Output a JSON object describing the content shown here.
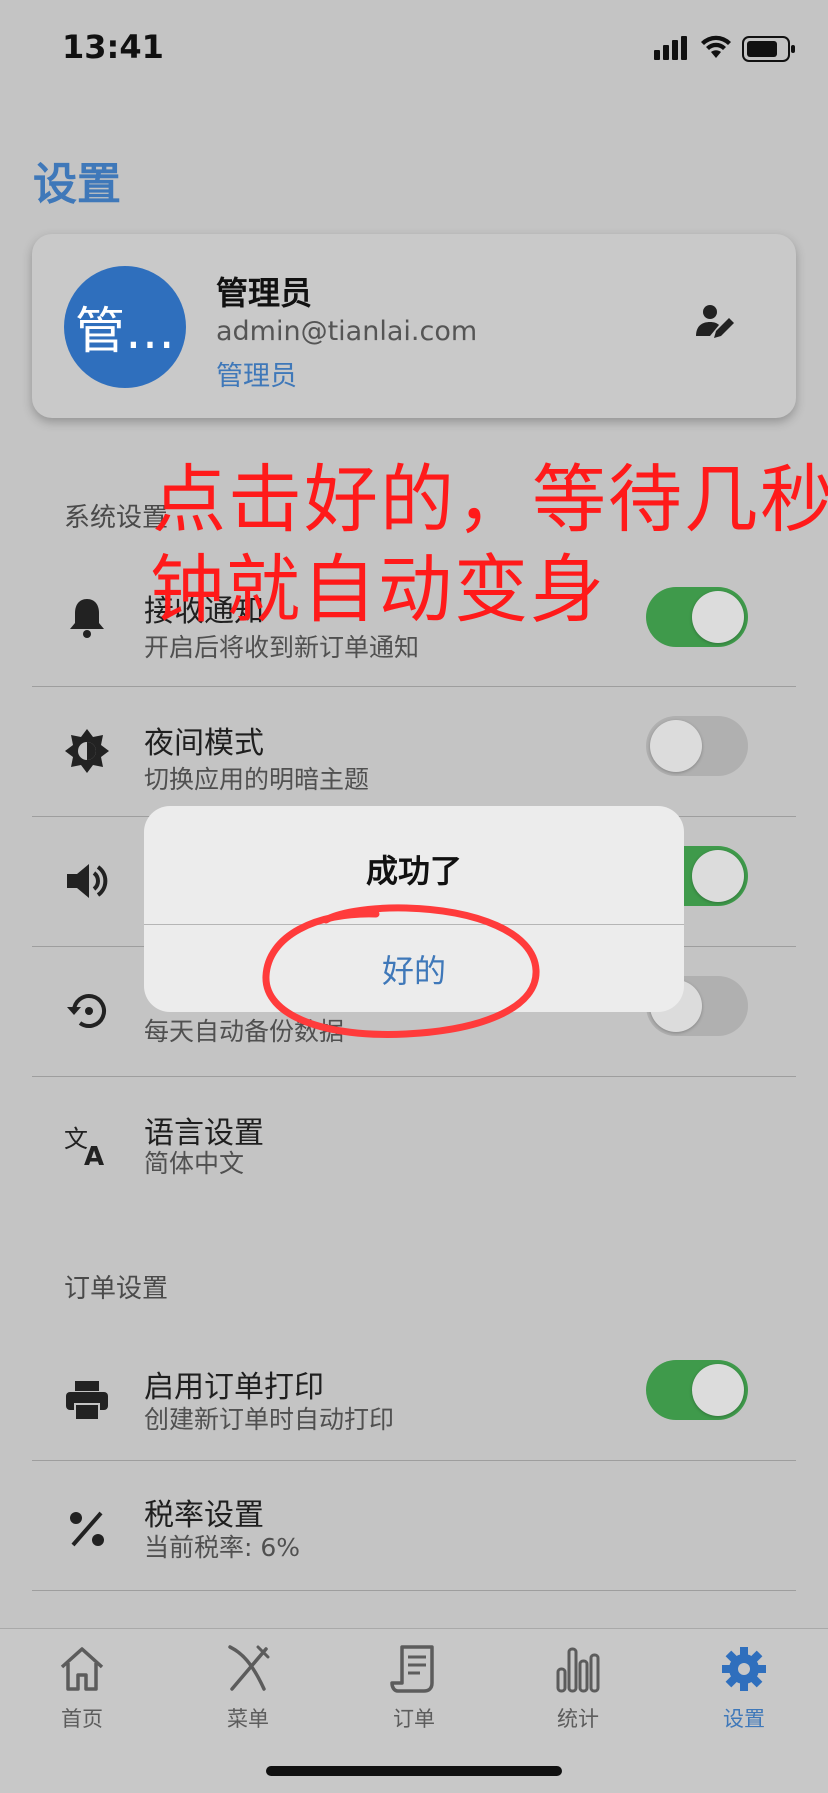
{
  "status_bar": {
    "time": "13:41"
  },
  "page": {
    "title": "设置"
  },
  "profile": {
    "avatar_text": "管…",
    "name": "管理员",
    "email": "admin@tianlai.com",
    "role": "管理员",
    "edit_icon": "user-edit-icon"
  },
  "sections": {
    "system_label": "系统设置",
    "order_label": "订单设置"
  },
  "system_settings": [
    {
      "icon": "bell-icon",
      "title": "接收通知",
      "subtitle": "开启后将收到新订单通知",
      "toggle": true
    },
    {
      "icon": "brightness-icon",
      "title": "夜间模式",
      "subtitle": "切换应用的明暗主题",
      "toggle": false
    },
    {
      "icon": "volume-icon",
      "title": "",
      "subtitle": "",
      "toggle": true
    },
    {
      "icon": "backup-restore-icon",
      "title": "",
      "subtitle": "每天自动备份数据",
      "toggle": false
    },
    {
      "icon": "translate-icon",
      "title": "语言设置",
      "subtitle": "简体中文"
    }
  ],
  "order_settings": [
    {
      "icon": "printer-icon",
      "title": "启用订单打印",
      "subtitle": "创建新订单时自动打印",
      "toggle": true
    },
    {
      "icon": "percent-icon",
      "title": "税率设置",
      "subtitle": "当前税率: 6%"
    }
  ],
  "annotation": {
    "line1": "点击好的，等待几秒",
    "line2": "钟就自动变身"
  },
  "dialog": {
    "title": "成功了",
    "ok_label": "好的"
  },
  "tabs": [
    {
      "label": "首页",
      "icon": "home-icon",
      "active": false
    },
    {
      "label": "菜单",
      "icon": "utensils-icon",
      "active": false
    },
    {
      "label": "订单",
      "icon": "receipt-icon",
      "active": false
    },
    {
      "label": "统计",
      "icon": "bar-chart-icon",
      "active": false
    },
    {
      "label": "设置",
      "icon": "gear-icon",
      "active": true
    }
  ],
  "colors": {
    "accent": "#3f78b9",
    "toggle_on": "#3f9a4b",
    "annotation": "#ff1a1a"
  }
}
